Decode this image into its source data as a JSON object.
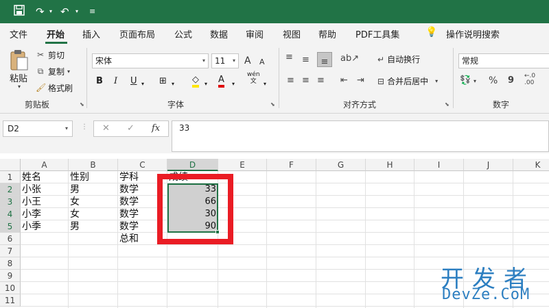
{
  "quick_access": {
    "save_icon": "save-icon",
    "redo_icon": "redo-icon",
    "undo_icon": "undo-icon",
    "customize_icon": "customize-icon"
  },
  "tabs": [
    "文件",
    "开始",
    "插入",
    "页面布局",
    "公式",
    "数据",
    "审阅",
    "视图",
    "帮助",
    "PDF工具集",
    "操作说明搜索"
  ],
  "active_tab": "开始",
  "ribbon": {
    "clipboard": {
      "paste": "粘贴",
      "cut": "剪切",
      "copy": "复制",
      "format_painter": "格式刷",
      "group_label": "剪贴板"
    },
    "font": {
      "font_name": "宋体",
      "font_size": "11",
      "bold": "B",
      "italic": "I",
      "underline": "U",
      "font_color_glyph": "A",
      "phonetic_glyph": "wén",
      "phonetic_sub": "文",
      "grow_glyph": "A",
      "shrink_glyph": "A",
      "group_label": "字体"
    },
    "alignment": {
      "wrap_text": "自动换行",
      "merge_center": "合并后居中",
      "group_label": "对齐方式"
    },
    "number": {
      "format": "常规",
      "percent": "%",
      "comma": "9",
      "inc_decimal": "←.0 .00",
      "group_label": "数字"
    }
  },
  "formula_bar": {
    "name_box": "D2",
    "cancel": "✕",
    "enter": "✓",
    "fx": "fx",
    "content": "33"
  },
  "sheet": {
    "columns": [
      "A",
      "B",
      "C",
      "D",
      "E",
      "F",
      "G",
      "H",
      "I",
      "J",
      "K"
    ],
    "rows": [
      "1",
      "2",
      "3",
      "4",
      "5",
      "6",
      "7",
      "8",
      "9",
      "10",
      "11"
    ],
    "headers": [
      "姓名",
      "性别",
      "学科",
      "成绩"
    ],
    "data": [
      [
        "小张",
        "男",
        "数学",
        "33"
      ],
      [
        "小王",
        "女",
        "数学",
        "66"
      ],
      [
        "小李",
        "女",
        "数学",
        "30"
      ],
      [
        "小季",
        "男",
        "数学",
        "90"
      ]
    ],
    "c6": "总和"
  },
  "watermark": {
    "line1": "开发者",
    "line2": "DevZe.CoM"
  },
  "colors": {
    "excel_green": "#217346",
    "highlight_red": "#ea1c24"
  }
}
